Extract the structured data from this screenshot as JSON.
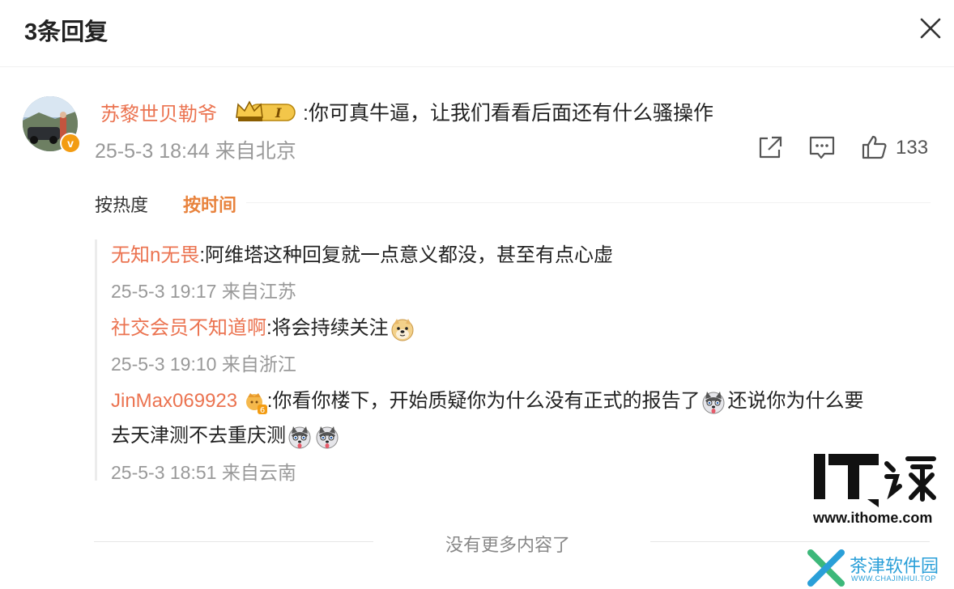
{
  "header": {
    "title": "3条回复"
  },
  "main_comment": {
    "username": "苏黎世贝勒爷",
    "badge_text": "I",
    "text": ":你可真牛逼，让我们看看后面还有什么骚操作",
    "date": "25-5-3 18:44",
    "location": "来自北京",
    "like_count": "133"
  },
  "sort": {
    "hot": "按热度",
    "time": "按时间",
    "active": "time"
  },
  "replies": [
    {
      "username": "无知n无畏",
      "text": ":阿维塔这种回复就一点意义都没，甚至有点心虚",
      "date": "25-5-3 19:17",
      "location": "来自江苏"
    },
    {
      "username": "社交会员不知道啊",
      "text": ":将会持续关注",
      "date": "25-5-3 19:10",
      "location": "来自浙江"
    },
    {
      "username": "JinMax069923",
      "badge_text": "6",
      "text_part1": ":你看你楼下，开始质疑你为什么没有正式的报告了",
      "text_part2": "还说你为什么要",
      "text_part3": "去天津测不去重庆测",
      "date": "25-5-3 18:51",
      "location": "来自云南"
    }
  ],
  "footer": {
    "text": "没有更多内容了"
  },
  "watermarks": {
    "ithome_url": "www.ithome.com",
    "cjr_name": "茶津软件园",
    "cjr_sub": "WWW.CHAJINHUI.TOP"
  },
  "colors": {
    "username": "#eb7350",
    "meta": "#999999",
    "verified": "#f39c12"
  }
}
